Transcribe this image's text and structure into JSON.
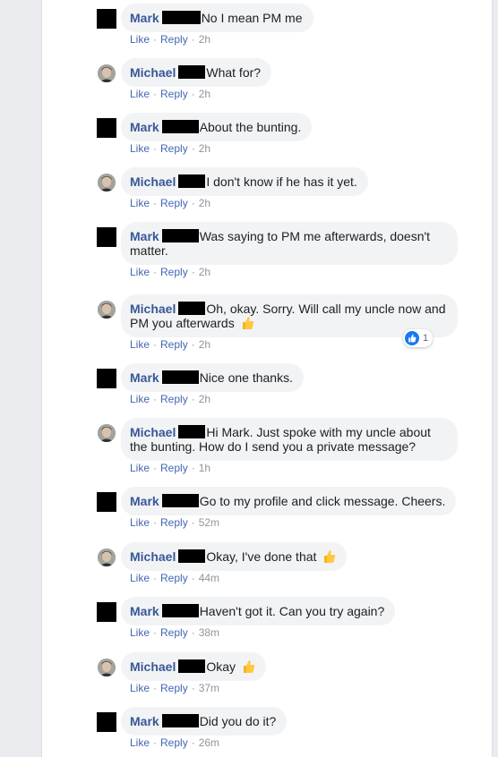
{
  "labels": {
    "like": "Like",
    "reply": "Reply",
    "separator": "·"
  },
  "comments": [
    {
      "author": "Mark",
      "text": "No I mean PM me",
      "time": "2h"
    },
    {
      "author": "Michael",
      "text": "What for?",
      "time": "2h"
    },
    {
      "author": "Mark",
      "text": "About the bunting.",
      "time": "2h"
    },
    {
      "author": "Michael",
      "text": "I don't know if he has it yet.",
      "time": "2h"
    },
    {
      "author": "Mark",
      "text": "Was saying to PM me afterwards, doesn't matter.",
      "time": "2h"
    },
    {
      "author": "Michael",
      "text": "Oh, okay. Sorry. Will call my uncle now and PM you afterwards",
      "time": "2h",
      "emoji": "thumbs-up-icon",
      "reaction_count": "1"
    },
    {
      "author": "Mark",
      "text": "Nice one thanks.",
      "time": "2h"
    },
    {
      "author": "Michael",
      "text": "Hi Mark. Just spoke with my uncle about the bunting. How do I send you a private message?",
      "time": "1h"
    },
    {
      "author": "Mark",
      "text": "Go to my profile and click message. Cheers.",
      "time": "52m"
    },
    {
      "author": "Michael",
      "text": "Okay, I've done that",
      "time": "44m",
      "emoji": "thumbs-up-icon"
    },
    {
      "author": "Mark",
      "text": "Haven't got it. Can you try again?",
      "time": "38m"
    },
    {
      "author": "Michael",
      "text": "Okay",
      "time": "37m",
      "emoji": "thumbs-up-icon"
    },
    {
      "author": "Mark",
      "text": "Did you do it?",
      "time": "26m"
    }
  ],
  "colors": {
    "name": "#385898",
    "link": "#4267b2",
    "bubble": "#f2f3f5",
    "like_badge": "#1877f2"
  }
}
